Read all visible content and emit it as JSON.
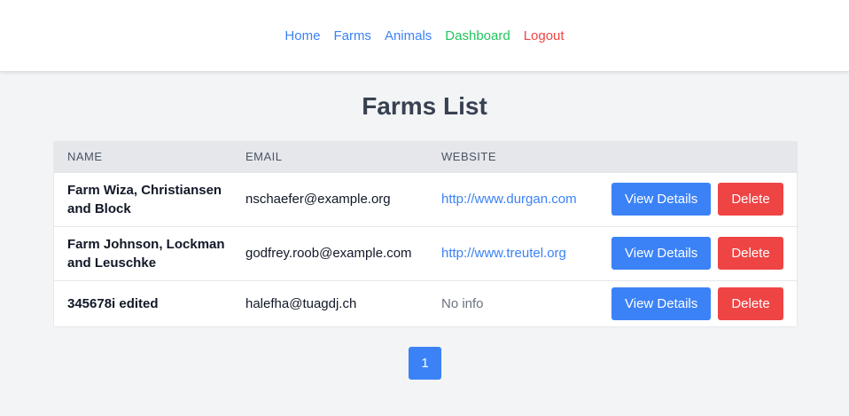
{
  "nav": {
    "home": "Home",
    "farms": "Farms",
    "animals": "Animals",
    "dashboard": "Dashboard",
    "logout": "Logout"
  },
  "page": {
    "title": "Farms List"
  },
  "table": {
    "headers": {
      "name": "NAME",
      "email": "EMAIL",
      "website": "WEBSITE"
    },
    "rows": [
      {
        "name": "Farm Wiza, Christiansen and Block",
        "email": "nschaefer@example.org",
        "website": "http://www.durgan.com",
        "view": "View Details",
        "delete": "Delete"
      },
      {
        "name": "Farm Johnson, Lockman and Leuschke",
        "email": "godfrey.roob@example.com",
        "website": "http://www.treutel.org",
        "view": "View Details",
        "delete": "Delete"
      },
      {
        "name": "345678i edited",
        "email": "halefha@tuagdj.ch",
        "website": "No info",
        "view": "View Details",
        "delete": "Delete"
      }
    ]
  },
  "pagination": {
    "current": "1"
  },
  "colors": {
    "primary": "#3b82f6",
    "success": "#22c55e",
    "danger": "#ef4444"
  }
}
